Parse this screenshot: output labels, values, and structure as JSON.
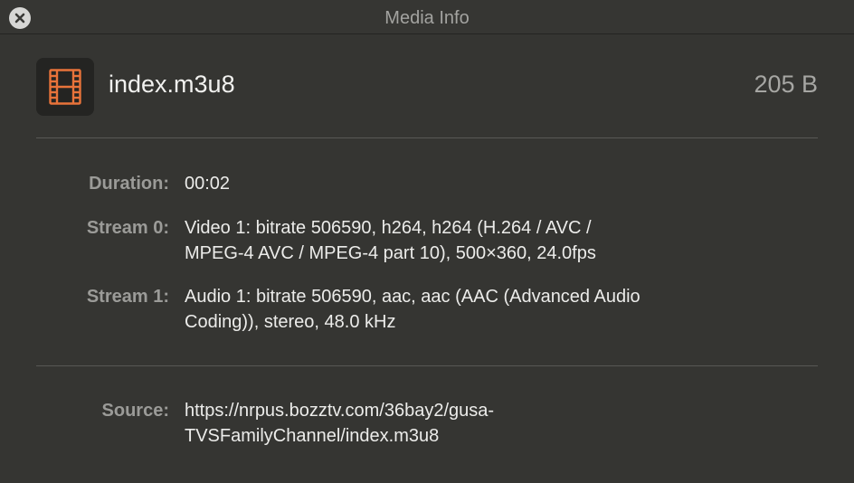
{
  "window": {
    "title": "Media Info"
  },
  "file": {
    "name": "index.m3u8",
    "size": "205 B",
    "icon": "film-strip-icon",
    "icon_color": "#e8733a"
  },
  "details": [
    {
      "label": "Duration:",
      "value": "00:02"
    },
    {
      "label": "Stream 0:",
      "value": "Video 1: bitrate 506590, h264, h264 (H.264 / AVC /\nMPEG-4 AVC / MPEG-4 part 10), 500×360, 24.0fps"
    },
    {
      "label": "Stream 1:",
      "value": "Audio 1: bitrate 506590, aac, aac (AAC (Advanced Audio\nCoding)), stereo, 48.0 kHz"
    }
  ],
  "source": {
    "label": "Source:",
    "value": "https://nrpus.bozztv.com/36bay2/gusa-\nTVSFamilyChannel/index.m3u8"
  }
}
